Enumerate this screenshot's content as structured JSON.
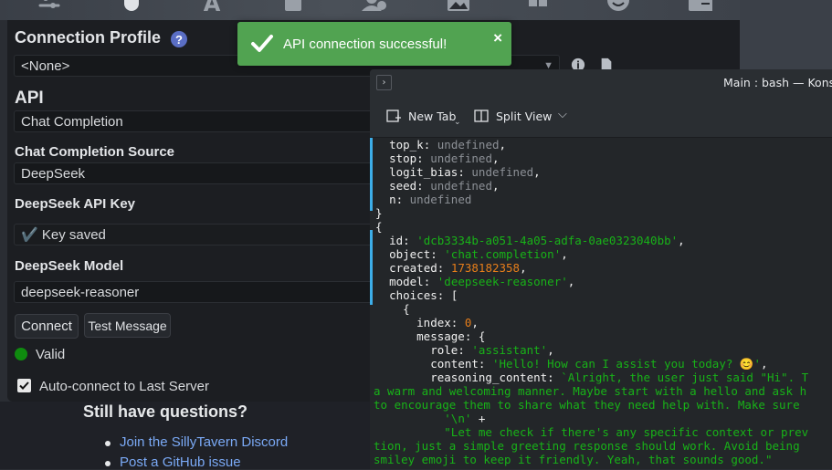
{
  "toast": {
    "message": "API connection successful!",
    "close": "×"
  },
  "panel": {
    "connection_profile_label": "Connection Profile",
    "help_glyph": "?",
    "profile_value": "<None>",
    "api_label": "API",
    "api_value": "Chat Completion",
    "source_label": "Chat Completion Source",
    "source_value": "DeepSeek",
    "key_label": "DeepSeek API Key",
    "key_value": "✔️ Key saved",
    "model_label": "DeepSeek Model",
    "model_value": "deepseek-reasoner",
    "connect_label": "Connect",
    "test_label": "Test Message",
    "status_text": "Valid",
    "status_color": "#0f8b0f",
    "autoconnect_label": "Auto-connect to Last Server",
    "autoconnect_checked": true
  },
  "footer": {
    "questions_heading": "Still have questions?",
    "links": [
      "Join the SillyTavern Discord",
      "Post a GitHub issue"
    ]
  },
  "konsole": {
    "window_title": "Main : bash — Kons",
    "new_tab_label": "New Tab",
    "split_view_label": "Split View",
    "accent": "#3daee9"
  },
  "terminal": {
    "l1k": "top_k",
    "l1v": "undefined",
    "l2k": "stop",
    "l2v": "undefined",
    "l3k": "logit_bias",
    "l3v": "undefined",
    "l4k": "seed",
    "l4v": "undefined",
    "l5k": "n",
    "l5v": "undefined",
    "close_brace": "}",
    "open_brace": "{",
    "id_key": "id",
    "id_val": "'dcb3334b-a051-4a05-adfa-0ae0323040bb'",
    "object_key": "object",
    "object_val": "'chat.completion'",
    "created_key": "created",
    "created_val": "1738182358",
    "model_key": "model",
    "model_val": "'deepseek-reasoner'",
    "choices_key": "choices",
    "choices_open": "[",
    "choice_open": "{",
    "index_key": "index",
    "index_val": "0",
    "message_key": "message",
    "message_open": "{",
    "role_key": "role",
    "role_val": "'assistant'",
    "content_key": "content",
    "content_val": "'Hello! How can I assist you today? 😊'",
    "reasoning_key": "reasoning_content",
    "reasoning_val": "`Alright, the user just said \"Hi\". T",
    "wrap1": "a warm and welcoming manner. Maybe start with a hello and ask h",
    "wrap2": "to encourage them to share what they need help with. Make sure",
    "nl_str": "'\\n'",
    "plus": "+",
    "next_str": "\"Let me check if there's any specific context or prev",
    "wrap3": "tion, just a simple greeting response should work. Avoid being",
    "wrap4": "smiley emoji to keep it friendly. Yeah, that sounds good.\""
  }
}
